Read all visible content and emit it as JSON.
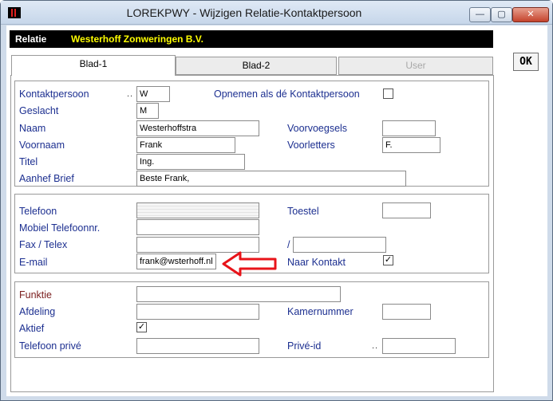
{
  "window": {
    "title": "LOREKPWY - Wijzigen Relatie-Kontaktpersoon",
    "min_glyph": "—",
    "max_glyph": "▢",
    "close_glyph": "✕"
  },
  "relatie": {
    "label": "Relatie",
    "value": "Westerhoff Zonweringen B.V."
  },
  "ok_button": "OK",
  "tabs": [
    {
      "label": "Blad-1",
      "active": true
    },
    {
      "label": "Blad-2",
      "active": false
    },
    {
      "label": "User",
      "active": false,
      "disabled": true
    }
  ],
  "group1": {
    "kontaktpersoon": {
      "label": "Kontaktpersoon",
      "dots": "..",
      "value": "W"
    },
    "opnemen": {
      "label": "Opnemen als dé Kontaktpersoon",
      "checked": false
    },
    "geslacht": {
      "label": "Geslacht",
      "value": "M"
    },
    "naam": {
      "label": "Naam",
      "value": "Westerhoffstra"
    },
    "voorvoegsels": {
      "label": "Voorvoegsels",
      "value": ""
    },
    "voornaam": {
      "label": "Voornaam",
      "value": "Frank"
    },
    "voorletters": {
      "label": "Voorletters",
      "value": "F."
    },
    "titel": {
      "label": "Titel",
      "value": "Ing."
    },
    "aanhef": {
      "label": "Aanhef Brief",
      "value": "Beste Frank,"
    }
  },
  "group2": {
    "telefoon": {
      "label": "Telefoon",
      "value": ""
    },
    "toestel": {
      "label": "Toestel",
      "value": ""
    },
    "mobiel": {
      "label": "Mobiel Telefoonnr.",
      "value": ""
    },
    "fax": {
      "label": "Fax / Telex",
      "value": ""
    },
    "fax_slash": "/",
    "fax2": {
      "value": ""
    },
    "email": {
      "label": "E-mail",
      "value": "frank@wsterhoff.nl"
    },
    "naar_kontakt": {
      "label": "Naar Kontakt",
      "checked": true
    }
  },
  "group3": {
    "functie": {
      "label": "Funktie",
      "value": ""
    },
    "afdeling": {
      "label": "Afdeling",
      "value": ""
    },
    "kamernummer": {
      "label": "Kamernummer",
      "value": ""
    },
    "aktief": {
      "label": "Aktief",
      "checked": true
    },
    "telefoon_prive": {
      "label": "Telefoon privé",
      "value": ""
    },
    "prive_id": {
      "label": "Privé-id",
      "dots": "..",
      "value": ""
    }
  },
  "colors": {
    "label": "#1c2f90",
    "label_maroon": "#7a1d1d",
    "relatie_value": "#ffff00",
    "annotation_arrow": "#e8141a"
  },
  "check_glyph": "✓"
}
